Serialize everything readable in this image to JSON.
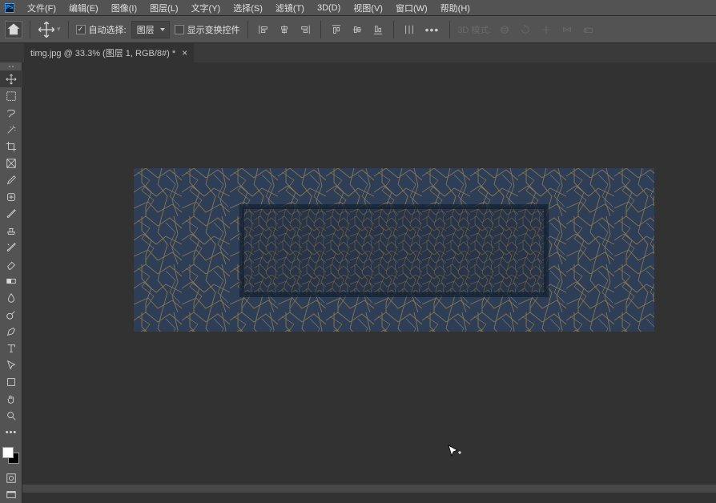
{
  "menu": {
    "items": [
      "文件(F)",
      "编辑(E)",
      "图像(I)",
      "图层(L)",
      "文字(Y)",
      "选择(S)",
      "滤镜(T)",
      "3D(D)",
      "视图(V)",
      "窗口(W)",
      "帮助(H)"
    ]
  },
  "options": {
    "auto_select_label": "自动选择:",
    "auto_select_mode": "图层",
    "show_transform_controls": "显示变换控件",
    "mode_3d_label": "3D 模式:"
  },
  "tab": {
    "title": "timg.jpg @ 33.3% (图层 1, RGB/8#) *"
  },
  "tools": {
    "names": [
      "move-tool",
      "rect-marquee-tool",
      "lasso-tool",
      "magic-wand-tool",
      "crop-tool",
      "frame-tool",
      "eyedropper-tool",
      "healing-brush-tool",
      "brush-tool",
      "clone-stamp-tool",
      "history-brush-tool",
      "eraser-tool",
      "gradient-tool",
      "blur-tool",
      "dodge-tool",
      "pen-tool",
      "type-tool",
      "path-select-tool",
      "shape-tool",
      "hand-tool",
      "zoom-tool"
    ]
  },
  "colors": {
    "foreground": "#ffffff",
    "background": "#000000"
  }
}
